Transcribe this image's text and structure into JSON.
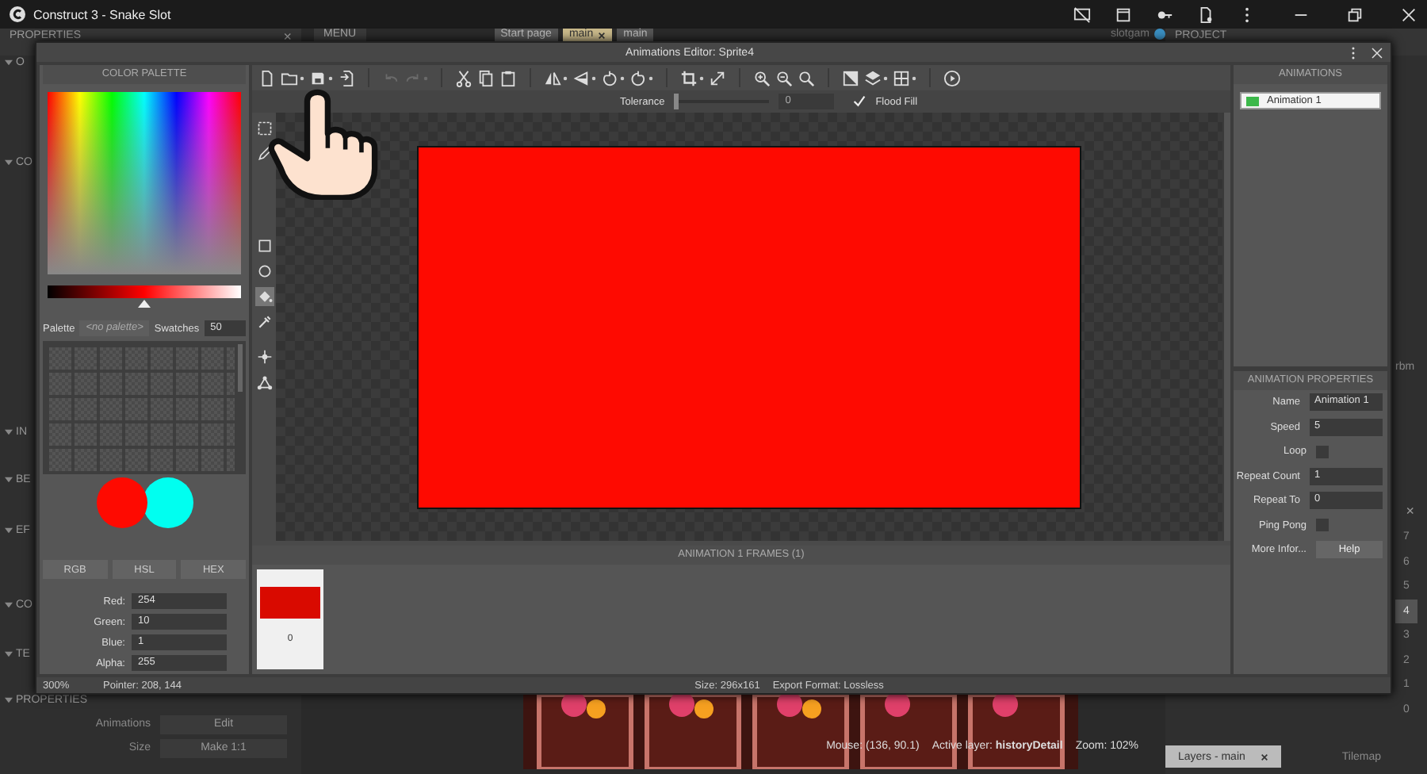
{
  "app": {
    "title": "Construct 3 - Snake Slot"
  },
  "background": {
    "left_panel": {
      "title": "PROPERTIES",
      "close": "×",
      "sections": [
        "O",
        "CO",
        "IN",
        "BE",
        "EF",
        "CO",
        "TE"
      ],
      "properties_section": "PROPERTIES",
      "rows": [
        {
          "label": "Animations",
          "button": "Edit"
        },
        {
          "label": "Size",
          "button": "Make 1:1"
        }
      ]
    },
    "menu": "MENU",
    "tabs": [
      {
        "label": "Start page",
        "selected": false,
        "closable": false
      },
      {
        "label": "main",
        "selected": true,
        "closable": true
      },
      {
        "label": "main",
        "selected": false,
        "closable": false
      }
    ],
    "project_label": "slotgam",
    "right_panel": {
      "title": "PROJECT",
      "fragment": "rbm",
      "close": "×",
      "layers": [
        {
          "label": "7",
          "selected": false
        },
        {
          "label": "6",
          "selected": false
        },
        {
          "label": "5",
          "selected": false
        },
        {
          "label": "4",
          "selected": true
        },
        {
          "label": "3",
          "selected": false
        },
        {
          "label": "2",
          "selected": false
        },
        {
          "label": "1",
          "selected": false
        },
        {
          "label": "0",
          "selected": false
        }
      ]
    },
    "status": {
      "mouse": "Mouse: (136, 90.1)",
      "layer": "Active layer: **historyDetail**",
      "zoom": "Zoom: 102%"
    },
    "bottom_tabs": [
      {
        "label": "Layers - main",
        "selected": true,
        "closable": true
      },
      {
        "label": "Tilemap",
        "selected": false,
        "closable": false
      }
    ]
  },
  "editor": {
    "title": "Animations Editor: Sprite4",
    "palette": {
      "title": "COLOR PALETTE",
      "lightness": {
        "level": 0.5
      },
      "palette_label": "Palette",
      "palette_value": "<no palette>",
      "swatches_label": "Swatches",
      "swatches_value": "50",
      "modes": [
        {
          "label": "RGB",
          "selected": false
        },
        {
          "label": "HSL",
          "selected": false
        },
        {
          "label": "HEX",
          "selected": false
        }
      ],
      "channels": [
        {
          "label": "Red:",
          "value": "254"
        },
        {
          "label": "Green:",
          "value": "10"
        },
        {
          "label": "Blue:",
          "value": "1"
        },
        {
          "label": "Alpha:",
          "value": "255"
        }
      ]
    },
    "toolbar": [
      {
        "kind": "file",
        "disabled": false,
        "caret": false
      },
      {
        "kind": "folder",
        "disabled": false,
        "caret": true
      },
      {
        "kind": "save",
        "disabled": false,
        "caret": true
      },
      {
        "kind": "import",
        "disabled": false,
        "caret": false
      },
      {
        "kind": "sep"
      },
      {
        "kind": "undo",
        "disabled": true,
        "caret": false
      },
      {
        "kind": "redo",
        "disabled": true,
        "caret": true
      },
      {
        "kind": "sep"
      },
      {
        "kind": "scissors",
        "disabled": false,
        "caret": false
      },
      {
        "kind": "copy",
        "disabled": false,
        "caret": false
      },
      {
        "kind": "clipboard",
        "disabled": false,
        "caret": false
      },
      {
        "kind": "sep"
      },
      {
        "kind": "flip",
        "disabled": false,
        "caret": true
      },
      {
        "kind": "mirror",
        "disabled": false,
        "caret": true
      },
      {
        "kind": "rotate-left",
        "disabled": false,
        "caret": true
      },
      {
        "kind": "rotate-right",
        "disabled": false,
        "caret": true
      },
      {
        "kind": "sep"
      },
      {
        "kind": "crop",
        "disabled": false,
        "caret": true
      },
      {
        "kind": "resize",
        "disabled": false,
        "caret": false
      },
      {
        "kind": "sep"
      },
      {
        "kind": "zoom-in",
        "disabled": false,
        "caret": false
      },
      {
        "kind": "zoom-out",
        "disabled": false,
        "caret": false
      },
      {
        "kind": "zoom",
        "disabled": false,
        "caret": false
      },
      {
        "kind": "sep"
      },
      {
        "kind": "contrast",
        "disabled": false,
        "caret": false
      },
      {
        "kind": "layers",
        "disabled": false,
        "caret": true
      },
      {
        "kind": "grid",
        "disabled": false,
        "caret": true
      },
      {
        "kind": "sep"
      },
      {
        "kind": "play",
        "disabled": false,
        "caret": false
      }
    ],
    "tolerance": {
      "label": "Tolerance",
      "level": 0,
      "value": "0"
    },
    "flood_fill": {
      "label": "Flood Fill",
      "checked": true
    },
    "tools": [
      {
        "kind": "select",
        "selected": false
      },
      {
        "kind": "pencil",
        "selected": false
      },
      {
        "kind": "rectangle",
        "selected": false
      },
      {
        "kind": "ellipse",
        "selected": false
      },
      {
        "kind": "bucket",
        "selected": true
      },
      {
        "kind": "dropper",
        "selected": false
      },
      {
        "kind": "origin",
        "selected": false
      },
      {
        "kind": "mesh",
        "selected": false
      }
    ],
    "frames": {
      "title": "ANIMATION 1 FRAMES (1)",
      "items": [
        {
          "label": "0"
        }
      ]
    },
    "animations": {
      "title": "ANIMATIONS",
      "items": [
        {
          "label": "Animation 1",
          "selected": true
        }
      ]
    },
    "properties": {
      "title": "ANIMATION PROPERTIES",
      "rows": [
        {
          "kind": "text",
          "label": "Name",
          "value": "Animation 1"
        },
        {
          "kind": "text",
          "label": "Speed",
          "value": "5"
        },
        {
          "kind": "checkbox",
          "label": "Loop",
          "checked": false
        },
        {
          "kind": "text",
          "label": "Repeat Count",
          "value": "1"
        },
        {
          "kind": "text",
          "label": "Repeat To",
          "value": "0"
        },
        {
          "kind": "checkbox",
          "label": "Ping Pong",
          "checked": false
        },
        {
          "kind": "button",
          "label": "More Infor...",
          "value": "Help"
        }
      ]
    },
    "status": {
      "zoom": "300%",
      "pointer": "Pointer: 208, 144",
      "size": "Size: 296x161",
      "format": "Export Format: Lossless"
    }
  }
}
